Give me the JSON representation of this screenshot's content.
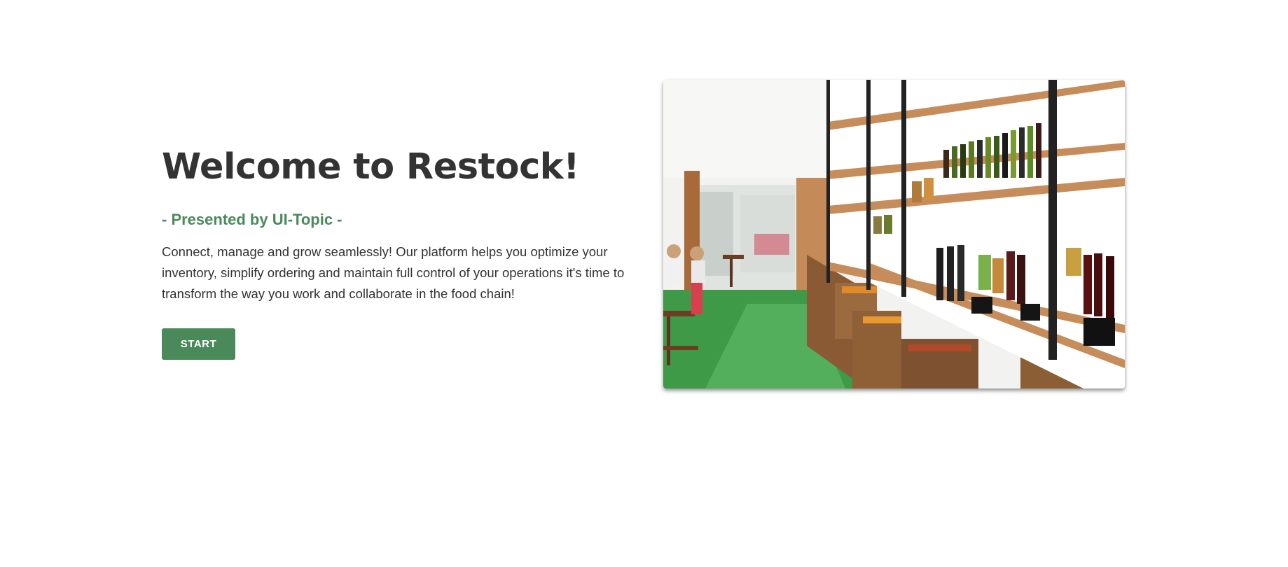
{
  "hero": {
    "title": "Welcome to Restock!",
    "subtitle": "- Presented by UI-Topic -",
    "description": "Connect, manage and grow seamlessly! Our platform helps you optimize your inventory, simplify ordering and maintain full control of your operations it's time to transform the way you work and collaborate in the food chain!",
    "start_label": "START"
  },
  "image": {
    "icon": "grocery-store-photo"
  },
  "colors": {
    "accent": "#4a8a5a",
    "text": "#333333",
    "background": "#ffffff"
  }
}
